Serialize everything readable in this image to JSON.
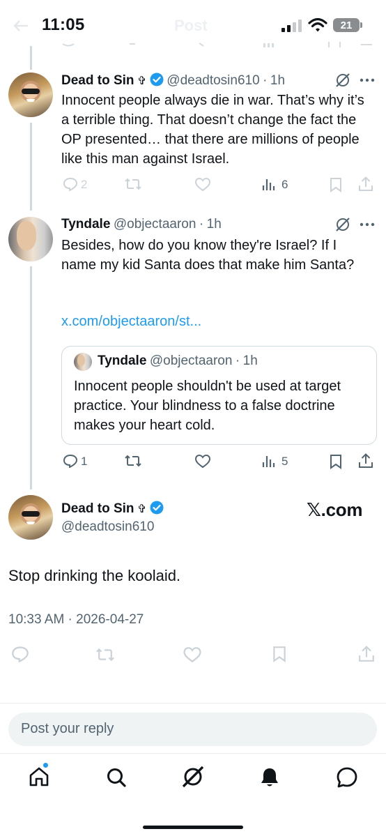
{
  "status_bar": {
    "time": "11:05",
    "battery": "21",
    "ghost_title": "Post"
  },
  "tweets": [
    {
      "name": "Dead to Sin",
      "name_symbol": "✞",
      "handle": "@deadtosin610",
      "sep": "·",
      "time": "1h",
      "text": "Innocent people always die in war. That’s why it’s a terrible thing. That doesn’t change the fact the OP presented… that there are millions of people like this man against Israel.",
      "replies": "2",
      "views": "6"
    },
    {
      "name": "Tyndale",
      "handle": "@objectaaron",
      "sep": "·",
      "time": "1h",
      "text": "Besides, how do you know they're Israel? If I name my kid Santa does that make him Santa?",
      "link": "x.com/objectaaron/st...",
      "replies": "1",
      "views": "5",
      "quote": {
        "name": "Tyndale",
        "handle": "@objectaaron",
        "sep": "·",
        "time": "1h",
        "text": "Innocent people shouldn't be used at target practice. Your blindness to a false doctrine makes your heart cold."
      }
    }
  ],
  "main_post": {
    "name": "Dead to Sin",
    "name_symbol": "✞",
    "handle": "@deadtosin610",
    "watermark": ".com",
    "text": "Stop drinking the koolaid.",
    "timestamp": "10:33 AM · 2026-04-27"
  },
  "reply_input": {
    "placeholder": "Post your reply"
  },
  "bottom_nav": [
    "home-icon",
    "search-icon",
    "grok-icon",
    "notifications-icon",
    "messages-icon"
  ],
  "colors": {
    "accent": "#1d9bf0",
    "text": "#0f1419",
    "secondary": "#536471",
    "thread_line": "#cfd9de"
  }
}
